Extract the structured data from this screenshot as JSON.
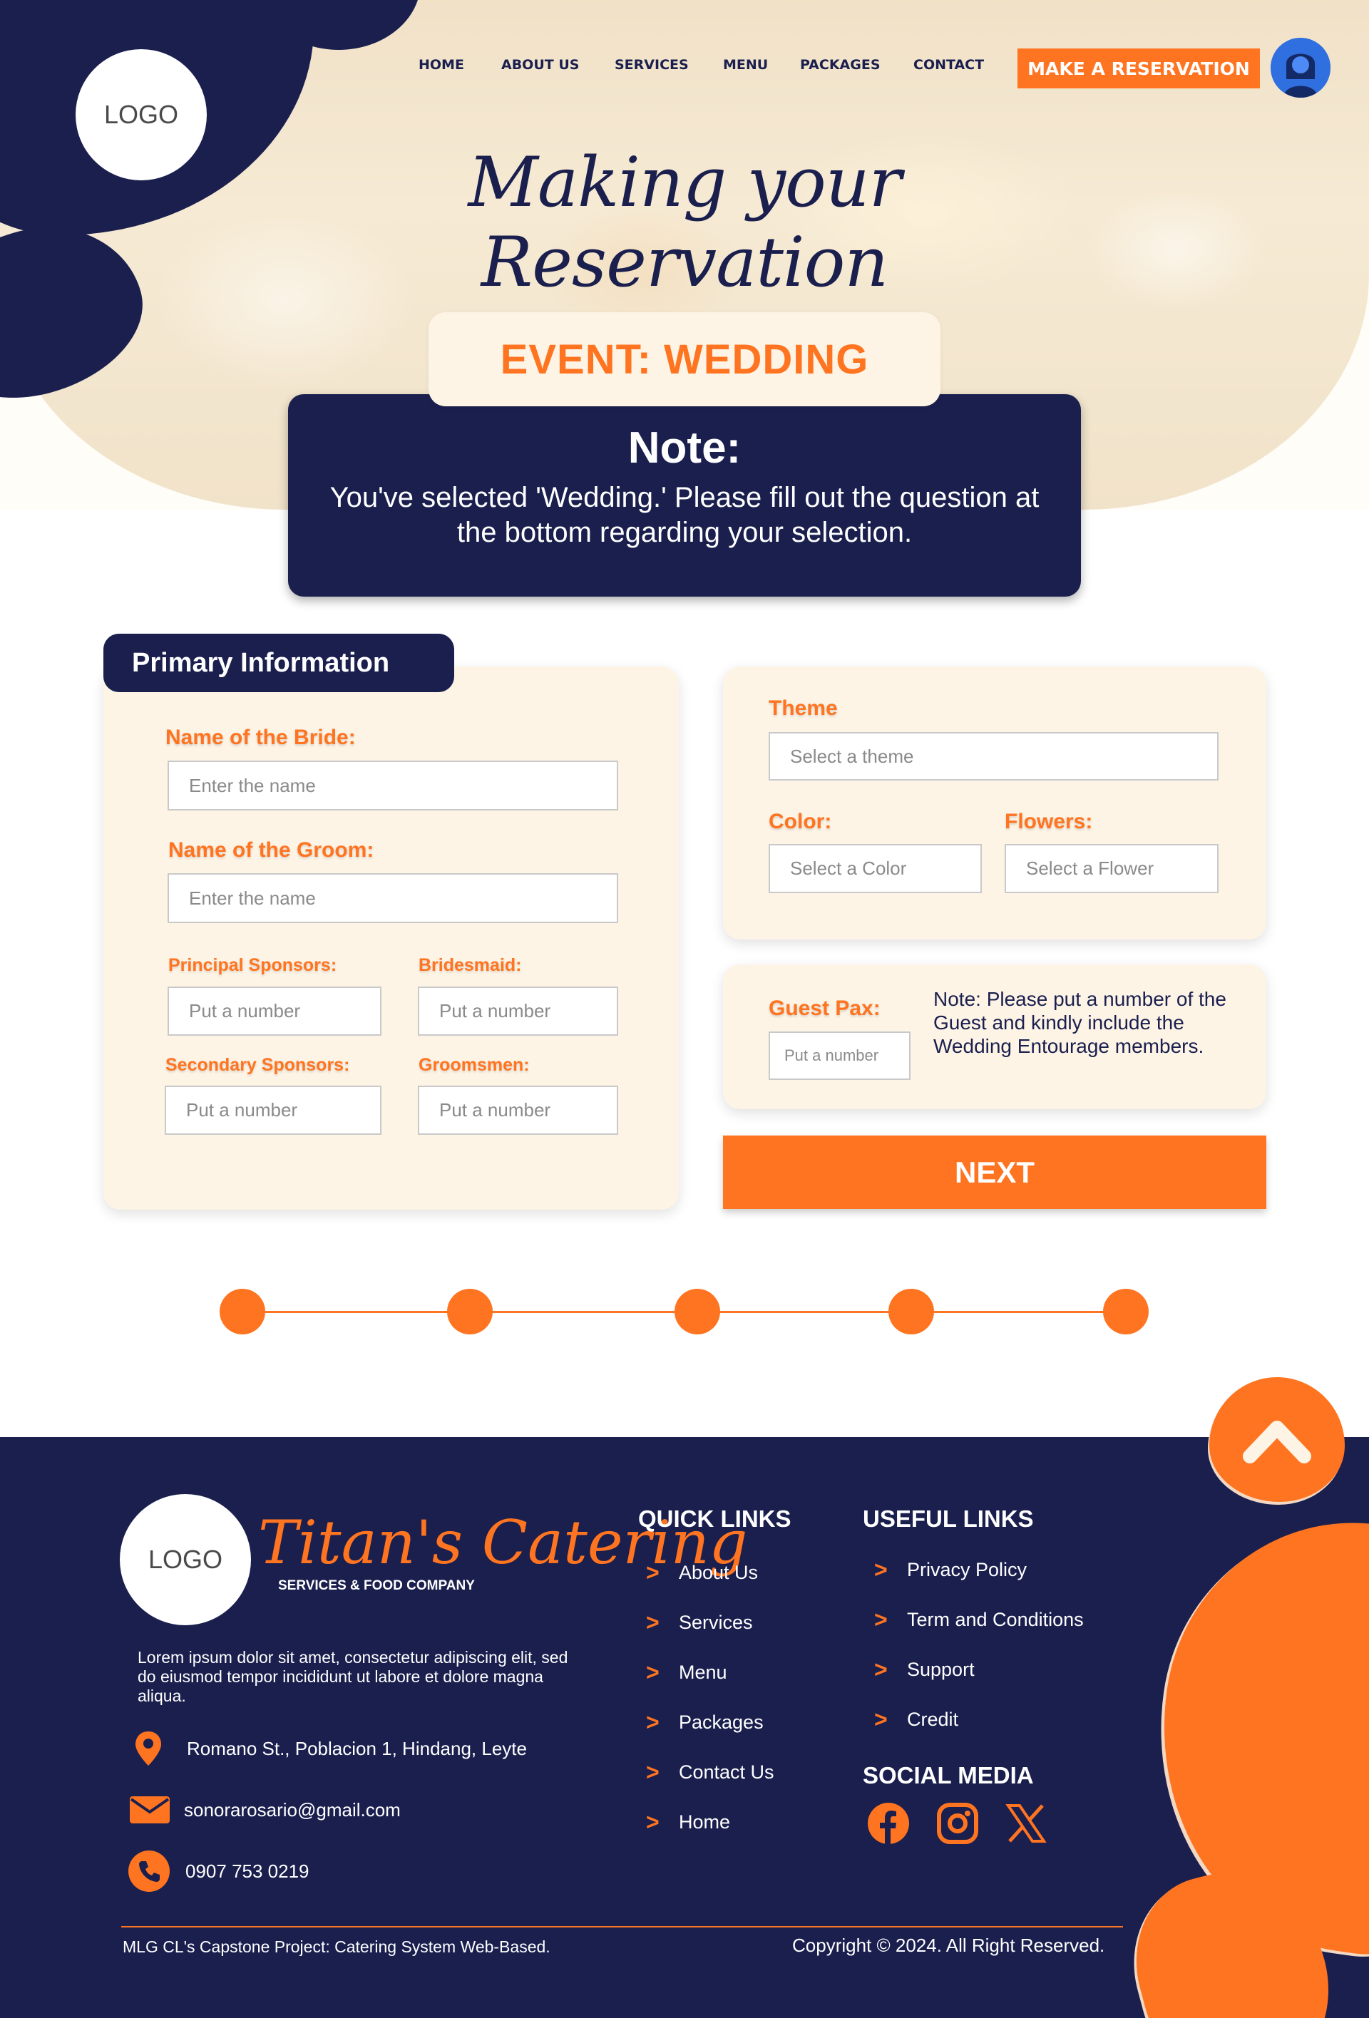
{
  "header": {
    "logo_text": "LOGO",
    "nav": [
      "HOME",
      "ABOUT US",
      "SERVICES",
      "MENU",
      "PACKAGES",
      "CONTACT"
    ],
    "reserve_label": "MAKE A RESERVATION",
    "title": "Making your Reservation"
  },
  "event": {
    "label": "EVENT: WEDDING",
    "note_title": "Note:",
    "note_text": "You've selected 'Wedding.' Please fill out the question at the bottom regarding your selection."
  },
  "primary": {
    "tab_label": "Primary Information",
    "bride_label": "Name of the Bride:",
    "bride_placeholder": "Enter the name",
    "groom_label": "Name of the Groom:",
    "groom_placeholder": "Enter the name",
    "principal_label": "Principal Sponsors:",
    "principal_placeholder": "Put a number",
    "bridesmaid_label": "Bridesmaid:",
    "bridesmaid_placeholder": "Put a number",
    "secondary_label": "Secondary Sponsors:",
    "secondary_placeholder": "Put a number",
    "groomsmen_label": "Groomsmen:",
    "groomsmen_placeholder": "Put a number"
  },
  "details": {
    "theme_label": "Theme",
    "theme_placeholder": "Select a theme",
    "color_label": "Color:",
    "color_placeholder": "Select a Color",
    "flowers_label": "Flowers:",
    "flowers_placeholder": "Select a Flower",
    "guest_label": "Guest Pax:",
    "guest_placeholder": "Put a number",
    "guest_note": "Note: Please put a number of the Guest and kindly include the Wedding Entourage members.",
    "next_label": "NEXT"
  },
  "stepper": {
    "steps": 5
  },
  "footer": {
    "logo_text": "LOGO",
    "brand": "Titan's Catering",
    "brand_sub": "SERVICES & FOOD COMPANY",
    "description": "Lorem ipsum dolor sit amet, consectetur adipiscing elit, sed do eiusmod tempor incididunt ut labore et dolore magna aliqua.",
    "address": "Romano St., Poblacion 1, Hindang, Leyte",
    "email": "sonorarosario@gmail.com",
    "phone": "0907 753 0219",
    "quick_links_title": "QUICK LINKS",
    "quick_links": [
      "About Us",
      "Services",
      "Menu",
      "Packages",
      "Contact Us",
      "Home"
    ],
    "useful_links_title": "USEFUL LINKS",
    "useful_links": [
      "Privacy Policy",
      "Term and Conditions",
      "Support",
      "Credit"
    ],
    "social_title": "SOCIAL MEDIA",
    "social_icons": [
      "facebook-icon",
      "instagram-icon",
      "x-icon"
    ],
    "project_note": "MLG CL's Capstone Project: Catering System Web-Based.",
    "copyright": "Copyright © 2024. All Right Reserved."
  },
  "colors": {
    "navy": "#1a1f4e",
    "orange": "#ff7420",
    "cream": "#fdf4e6"
  }
}
